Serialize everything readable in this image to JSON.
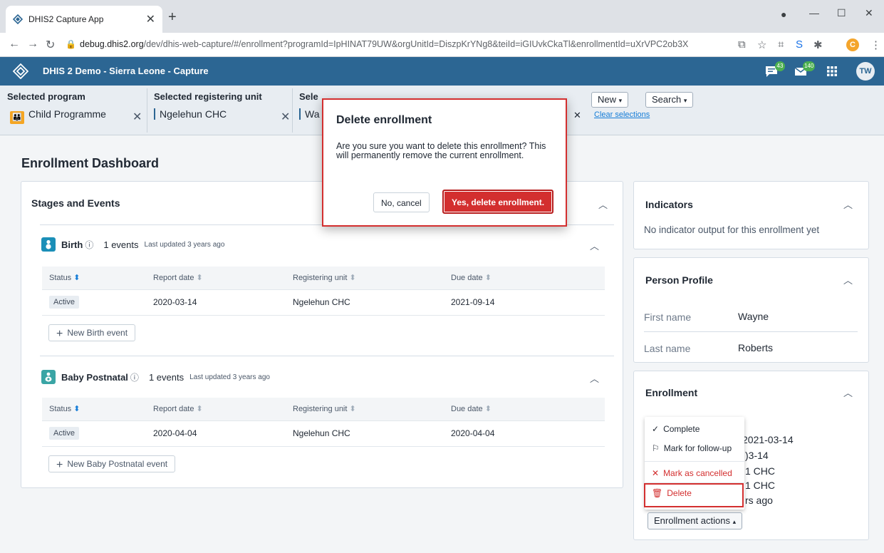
{
  "browser": {
    "tab_title": "DHIS2 Capture App",
    "url_host": "debug.dhis2.org",
    "url_path": "/dev/dhis-web-capture/#/enrollment?programId=IpHINAT79UW&orgUnitId=DiszpKrYNg8&teiId=iGIUvkCkaTl&enrollmentId=uXrVPC2ob3X",
    "profile_initial": "C"
  },
  "header": {
    "title": "DHIS 2 Demo - Sierra Leone - Capture",
    "interpretations_count": "43",
    "messages_count": "140",
    "user_initials": "TW"
  },
  "selection": {
    "program_label": "Selected program",
    "program_value": "Child Programme",
    "org_label": "Selected registering unit",
    "org_value": "Ngelehun CHC",
    "person_label": "Sele",
    "person_value": "Wa",
    "new_label": "New",
    "search_label": "Search",
    "clear_label": "Clear selections"
  },
  "dashboard": {
    "title": "Enrollment Dashboard",
    "stages_title": "Stages and Events",
    "columns": [
      "Status",
      "Report date",
      "Registering unit",
      "Due date"
    ],
    "stages": [
      {
        "name": "Birth",
        "count": "1 events",
        "updated": "Last updated 3 years ago",
        "rows": [
          [
            "Active",
            "2020-03-14",
            "Ngelehun CHC",
            "2021-09-14"
          ]
        ],
        "new_label": "New Birth event"
      },
      {
        "name": "Baby Postnatal",
        "count": "1 events",
        "updated": "Last updated 3 years ago",
        "rows": [
          [
            "Active",
            "2020-04-04",
            "Ngelehun CHC",
            "2020-04-04"
          ]
        ],
        "new_label": "New Baby Postnatal event"
      }
    ]
  },
  "indicators": {
    "title": "Indicators",
    "empty": "No indicator output for this enrollment yet"
  },
  "profile": {
    "title": "Person Profile",
    "first_name_label": "First name",
    "first_name": "Wayne",
    "last_name_label": "Last name",
    "last_name": "Roberts"
  },
  "enrollment": {
    "title": "Enrollment",
    "line1": "2021-03-14",
    "line2": ")3-14",
    "line3": "1 CHC",
    "line4": "1 CHC",
    "line5": "rs ago",
    "menu": {
      "complete": "Complete",
      "followup": "Mark for follow-up",
      "cancelled": "Mark as cancelled",
      "delete": "Delete"
    },
    "actions_label": "Enrollment actions"
  },
  "modal": {
    "title": "Delete enrollment",
    "body": "Are you sure you want to delete this enrollment? This will permanently remove the current enrollment.",
    "cancel": "No, cancel",
    "confirm": "Yes, delete enrollment."
  },
  "colors": {
    "header": "#2c6693",
    "danger": "#d32f2f",
    "stage_icon": "#1b8fb8"
  }
}
